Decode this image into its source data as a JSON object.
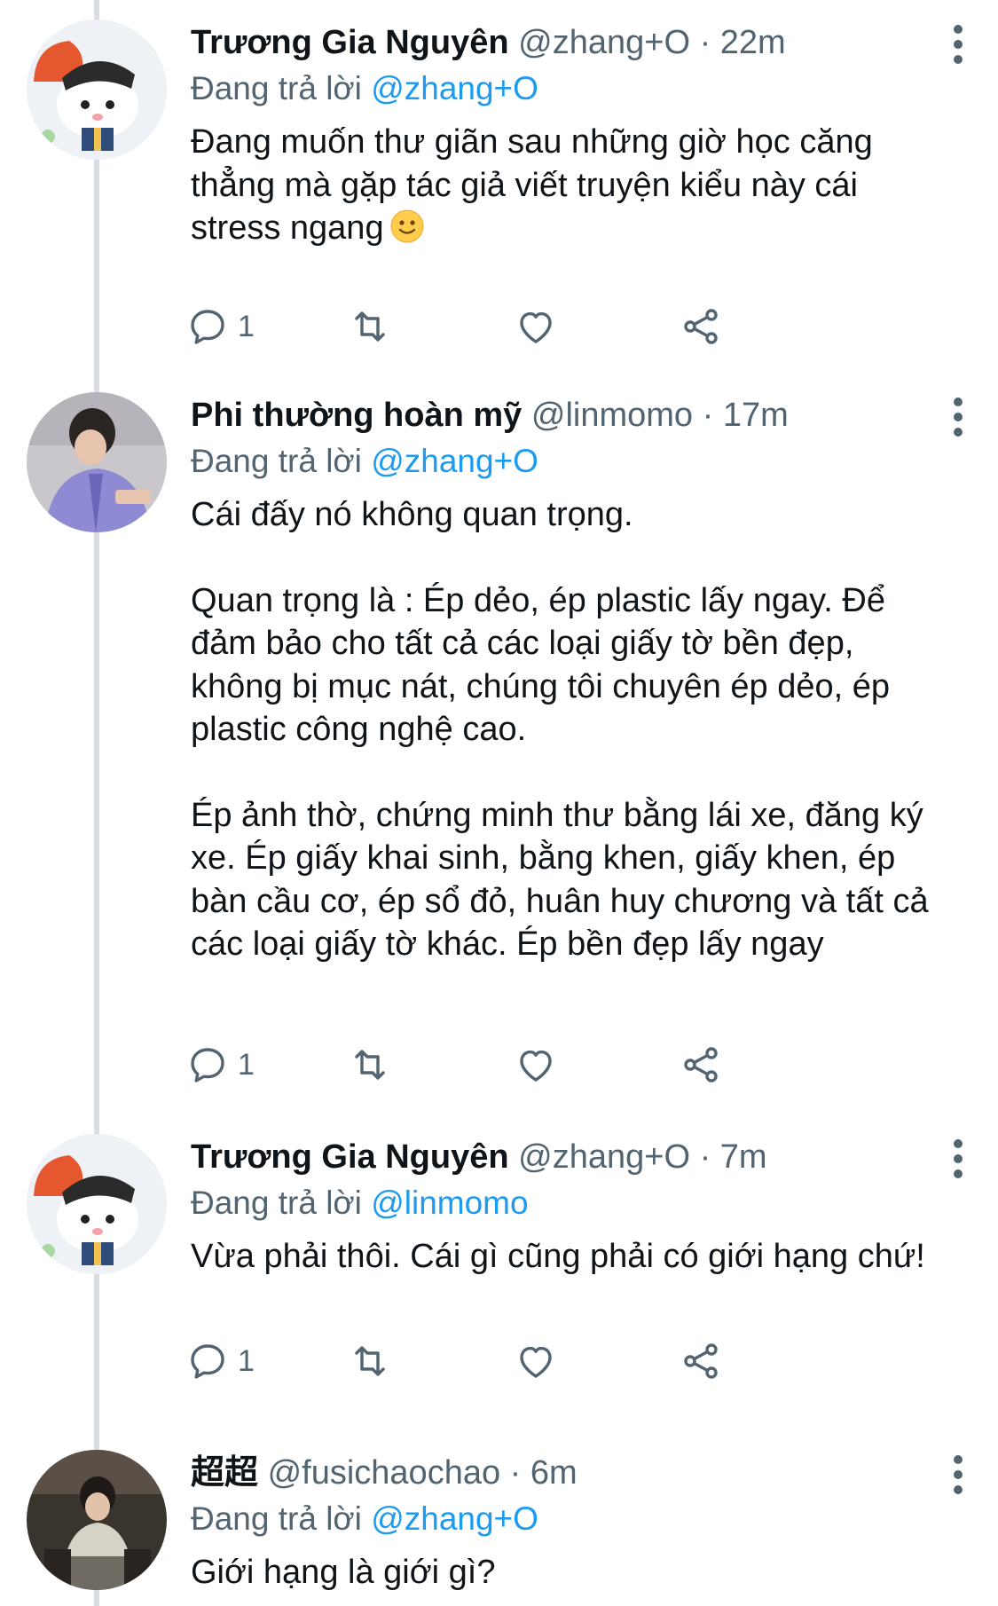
{
  "tweets": [
    {
      "author_name": "Trương Gia Nguyên",
      "handle": "@zhang+O",
      "separator": "·",
      "time": "22m",
      "replying_prefix": "Đang trả lời",
      "replying_to": "@zhang+O",
      "paragraphs": [
        "Đang muốn thư giãn sau những giờ học căng thẳng mà gặp tác giả viết truyện kiểu này cái stress ngang"
      ],
      "emoji": "slightly-smiling-face",
      "reply_count": "1",
      "avatar": "cartoon-dog-avatar"
    },
    {
      "author_name": "Phi thường hoàn mỹ",
      "handle": "@linmomo",
      "separator": "·",
      "time": "17m",
      "replying_prefix": "Đang trả lời",
      "replying_to": "@zhang+O",
      "paragraphs": [
        "Cái đấy nó không quan trọng.",
        "Quan trọng là : Ép dẻo, ép plastic lấy ngay. Để đảm bảo cho tất cả các loại giấy tờ bền đẹp, không bị mục nát, chúng tôi chuyên ép dẻo, ép plastic công nghệ cao.",
        "Ép ảnh thờ, chứng minh thư bằng lái xe, đăng ký xe. Ép giấy khai sinh, bằng khen, giấy khen, ép bàn cầu cơ, ép sổ đỏ, huân huy chương và tất cả các loại giấy tờ khác. Ép bền đẹp lấy ngay"
      ],
      "reply_count": "1",
      "avatar": "person-photo-avatar"
    },
    {
      "author_name": "Trương Gia Nguyên",
      "handle": "@zhang+O",
      "separator": "·",
      "time": "7m",
      "replying_prefix": "Đang trả lời",
      "replying_to": "@linmomo",
      "paragraphs": [
        "Vừa phải thôi. Cái gì cũng phải có giới hạng chứ!"
      ],
      "reply_count": "1",
      "avatar": "cartoon-dog-avatar"
    },
    {
      "author_name": "超超",
      "handle": "@fusichaochao",
      "separator": "·",
      "time": "6m",
      "replying_prefix": "Đang trả lời",
      "replying_to": "@zhang+O",
      "paragraphs": [
        "Giới hạng là giới gì?"
      ],
      "avatar": "person-seated-photo-avatar"
    }
  ],
  "icons": {
    "reply": "reply-icon",
    "retweet": "retweet-icon",
    "like": "like-icon",
    "share": "share-icon",
    "more": "more-options-icon"
  },
  "colors": {
    "text": "#0f1419",
    "secondary": "#536471",
    "link": "#1d9bf0",
    "thread_line": "#d9dde1"
  }
}
